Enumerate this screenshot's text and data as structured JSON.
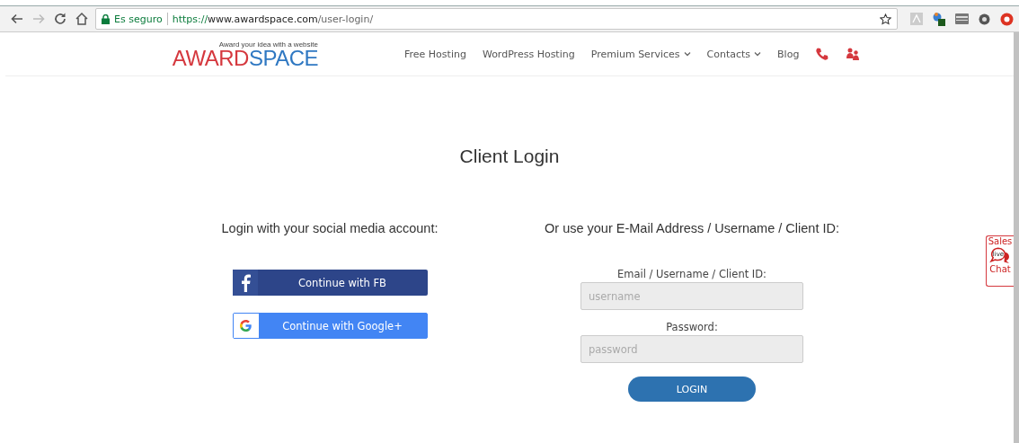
{
  "browser": {
    "security": "Es seguro",
    "url_scheme": "https://",
    "url_host": "www.awardspace.com",
    "url_path": "/user-login/"
  },
  "header": {
    "logo_tagline": "Award your idea with a website",
    "logo_part_1": "AWARD",
    "logo_part_2": "SPACE",
    "nav": [
      {
        "label": "Free Hosting",
        "dropdown": false
      },
      {
        "label": "WordPress Hosting",
        "dropdown": false
      },
      {
        "label": "Premium Services",
        "dropdown": true
      },
      {
        "label": "Contacts",
        "dropdown": true
      },
      {
        "label": "Blog",
        "dropdown": false
      }
    ]
  },
  "title": "Client Login",
  "social": {
    "heading": "Login with your social media account:",
    "buttons": [
      {
        "kind": "facebook",
        "label": "Continue with FB"
      },
      {
        "kind": "google",
        "label": "Continue with Google+"
      }
    ]
  },
  "form": {
    "heading": "Or use your E-Mail Address / Username / Client ID:",
    "fields": [
      {
        "label": "Email / Username / Client ID:",
        "placeholder": "username"
      },
      {
        "label": "Password:",
        "placeholder": "password"
      }
    ],
    "submit": "LOGIN"
  },
  "chat_tab": {
    "top": "Sales",
    "badge": "live",
    "bottom": "Chat"
  }
}
